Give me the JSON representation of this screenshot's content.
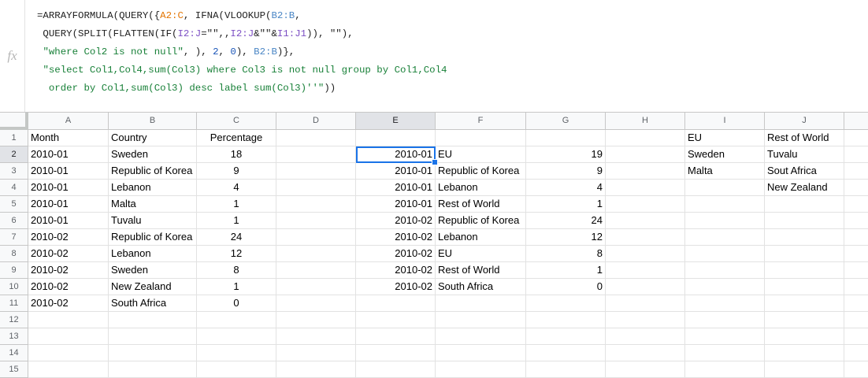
{
  "formula_bar": {
    "fx_label": "fx",
    "lines": [
      [
        {
          "t": "=ARRAYFORMULA(QUERY({",
          "c": ""
        },
        {
          "t": "A2:C",
          "c": "f-ref1"
        },
        {
          "t": ", IFNA(VLOOKUP(",
          "c": ""
        },
        {
          "t": "B2:B",
          "c": "f-ref2"
        },
        {
          "t": ",",
          "c": ""
        }
      ],
      [
        {
          "t": " QUERY(SPLIT(FLATTEN(IF(",
          "c": ""
        },
        {
          "t": "I2:J",
          "c": "f-ref3"
        },
        {
          "t": "=\"\",,",
          "c": ""
        },
        {
          "t": "I2:J",
          "c": "f-ref3"
        },
        {
          "t": "&\"\"&",
          "c": ""
        },
        {
          "t": "I1:J1",
          "c": "f-ref3"
        },
        {
          "t": ")), \"\"),",
          "c": ""
        }
      ],
      [
        {
          "t": " ",
          "c": ""
        },
        {
          "t": "\"where Col2 is not null\"",
          "c": "f-str"
        },
        {
          "t": ", ), ",
          "c": ""
        },
        {
          "t": "2",
          "c": "f-num"
        },
        {
          "t": ", ",
          "c": ""
        },
        {
          "t": "0",
          "c": "f-num"
        },
        {
          "t": "), ",
          "c": ""
        },
        {
          "t": "B2:B",
          "c": "f-ref2"
        },
        {
          "t": ")},",
          "c": ""
        }
      ],
      [
        {
          "t": " ",
          "c": ""
        },
        {
          "t": "\"select Col1,Col4,sum(Col3) where Col3 is not null group by Col1,Col4",
          "c": "f-str"
        }
      ],
      [
        {
          "t": "  order by Col1,sum(Col3) desc label sum(Col3)''\"",
          "c": "f-str"
        },
        {
          "t": "))",
          "c": ""
        }
      ]
    ]
  },
  "columns": [
    "A",
    "B",
    "C",
    "D",
    "E",
    "F",
    "G",
    "H",
    "I",
    "J"
  ],
  "rows": [
    [
      "Month",
      "Country",
      "Percentage",
      "",
      "",
      "",
      "",
      "",
      "EU",
      "Rest of World"
    ],
    [
      "2010-01",
      "Sweden",
      "18",
      "",
      "2010-01",
      "EU",
      "19",
      "",
      "Sweden",
      "Tuvalu"
    ],
    [
      "2010-01",
      "Republic of Korea",
      "9",
      "",
      "2010-01",
      "Republic of Korea",
      "9",
      "",
      "Malta",
      "Sout Africa"
    ],
    [
      "2010-01",
      "Lebanon",
      "4",
      "",
      "2010-01",
      "Lebanon",
      "4",
      "",
      "",
      "New Zealand"
    ],
    [
      "2010-01",
      "Malta",
      "1",
      "",
      "2010-01",
      "Rest of World",
      "1",
      "",
      "",
      ""
    ],
    [
      "2010-01",
      "Tuvalu",
      "1",
      "",
      "2010-02",
      "Republic of Korea",
      "24",
      "",
      "",
      ""
    ],
    [
      "2010-02",
      "Republic of Korea",
      "24",
      "",
      "2010-02",
      "Lebanon",
      "12",
      "",
      "",
      ""
    ],
    [
      "2010-02",
      "Lebanon",
      "12",
      "",
      "2010-02",
      "EU",
      "8",
      "",
      "",
      ""
    ],
    [
      "2010-02",
      "Sweden",
      "8",
      "",
      "2010-02",
      "Rest of World",
      "1",
      "",
      "",
      ""
    ],
    [
      "2010-02",
      "New Zealand",
      "1",
      "",
      "2010-02",
      "South Africa",
      "0",
      "",
      "",
      ""
    ],
    [
      "2010-02",
      "South Africa",
      "0",
      "",
      "",
      "",
      "",
      "",
      "",
      ""
    ],
    [
      "",
      "",
      "",
      "",
      "",
      "",
      "",
      "",
      "",
      ""
    ],
    [
      "",
      "",
      "",
      "",
      "",
      "",
      "",
      "",
      "",
      ""
    ],
    [
      "",
      "",
      "",
      "",
      "",
      "",
      "",
      "",
      "",
      ""
    ],
    [
      "",
      "",
      "",
      "",
      "",
      "",
      "",
      "",
      "",
      ""
    ]
  ],
  "row_numbers": [
    "1",
    "2",
    "3",
    "4",
    "5",
    "6",
    "7",
    "8",
    "9",
    "10",
    "11",
    "12",
    "13",
    "14",
    "15"
  ],
  "selection": {
    "cell": "E2"
  },
  "colors": {
    "selection": "#1a73e8",
    "header_bg": "#f8f9fa",
    "gridline": "#e2e2e2"
  }
}
